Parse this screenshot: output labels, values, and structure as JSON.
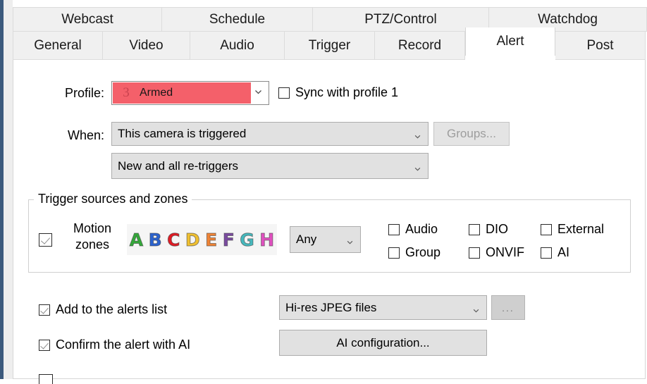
{
  "window": {
    "accent_border_color": "#3c5a7d"
  },
  "tabs": {
    "top_row": [
      {
        "label": "Webcast",
        "active": false
      },
      {
        "label": "Schedule",
        "active": false
      },
      {
        "label": "PTZ/Control",
        "active": false
      },
      {
        "label": "Watchdog",
        "active": false
      }
    ],
    "bottom_row": [
      {
        "label": "General",
        "active": false
      },
      {
        "label": "Video",
        "active": false
      },
      {
        "label": "Audio",
        "active": false
      },
      {
        "label": "Trigger",
        "active": false
      },
      {
        "label": "Record",
        "active": false
      },
      {
        "label": "Alert",
        "active": true
      },
      {
        "label": "Post",
        "active": false
      }
    ]
  },
  "profile": {
    "label": "Profile:",
    "number": "3",
    "name": "Armed",
    "swatch_color": "#f4606a",
    "chevron": "chevron-down-icon",
    "sync_checkbox": {
      "label": "Sync with profile 1",
      "checked": false
    }
  },
  "when": {
    "label": "When:",
    "condition_value": "This camera is triggered",
    "retrigger_value": "New and all re-triggers",
    "groups_button": {
      "label": "Groups...",
      "disabled": true
    }
  },
  "trigger_sources": {
    "group_title": "Trigger sources and zones",
    "motion_zones": {
      "label_line1": "Motion",
      "label_line2": "zones",
      "checked": true,
      "zones": [
        {
          "letter": "A",
          "color": "#34a83a"
        },
        {
          "letter": "B",
          "color": "#2b63d0"
        },
        {
          "letter": "C",
          "color": "#e01b24"
        },
        {
          "letter": "D",
          "color": "#f0c030"
        },
        {
          "letter": "E",
          "color": "#ef8335"
        },
        {
          "letter": "F",
          "color": "#7a4ba0"
        },
        {
          "letter": "G",
          "color": "#46b8bd"
        },
        {
          "letter": "H",
          "color": "#e151c0"
        }
      ],
      "mode_value": "Any"
    },
    "source_checkboxes": [
      {
        "label": "Audio",
        "checked": false
      },
      {
        "label": "DIO",
        "checked": false
      },
      {
        "label": "External",
        "checked": false
      },
      {
        "label": "Group",
        "checked": false
      },
      {
        "label": "ONVIF",
        "checked": false
      },
      {
        "label": "AI",
        "checked": false
      }
    ]
  },
  "actions": {
    "add_to_alerts": {
      "label": "Add to the alerts list",
      "checked": true
    },
    "alerts_format_value": "Hi-res JPEG files",
    "browse_button_label": "...",
    "confirm_with_ai": {
      "label": "Confirm the alert with AI",
      "checked": true
    },
    "ai_config_button_label": "AI configuration..."
  }
}
